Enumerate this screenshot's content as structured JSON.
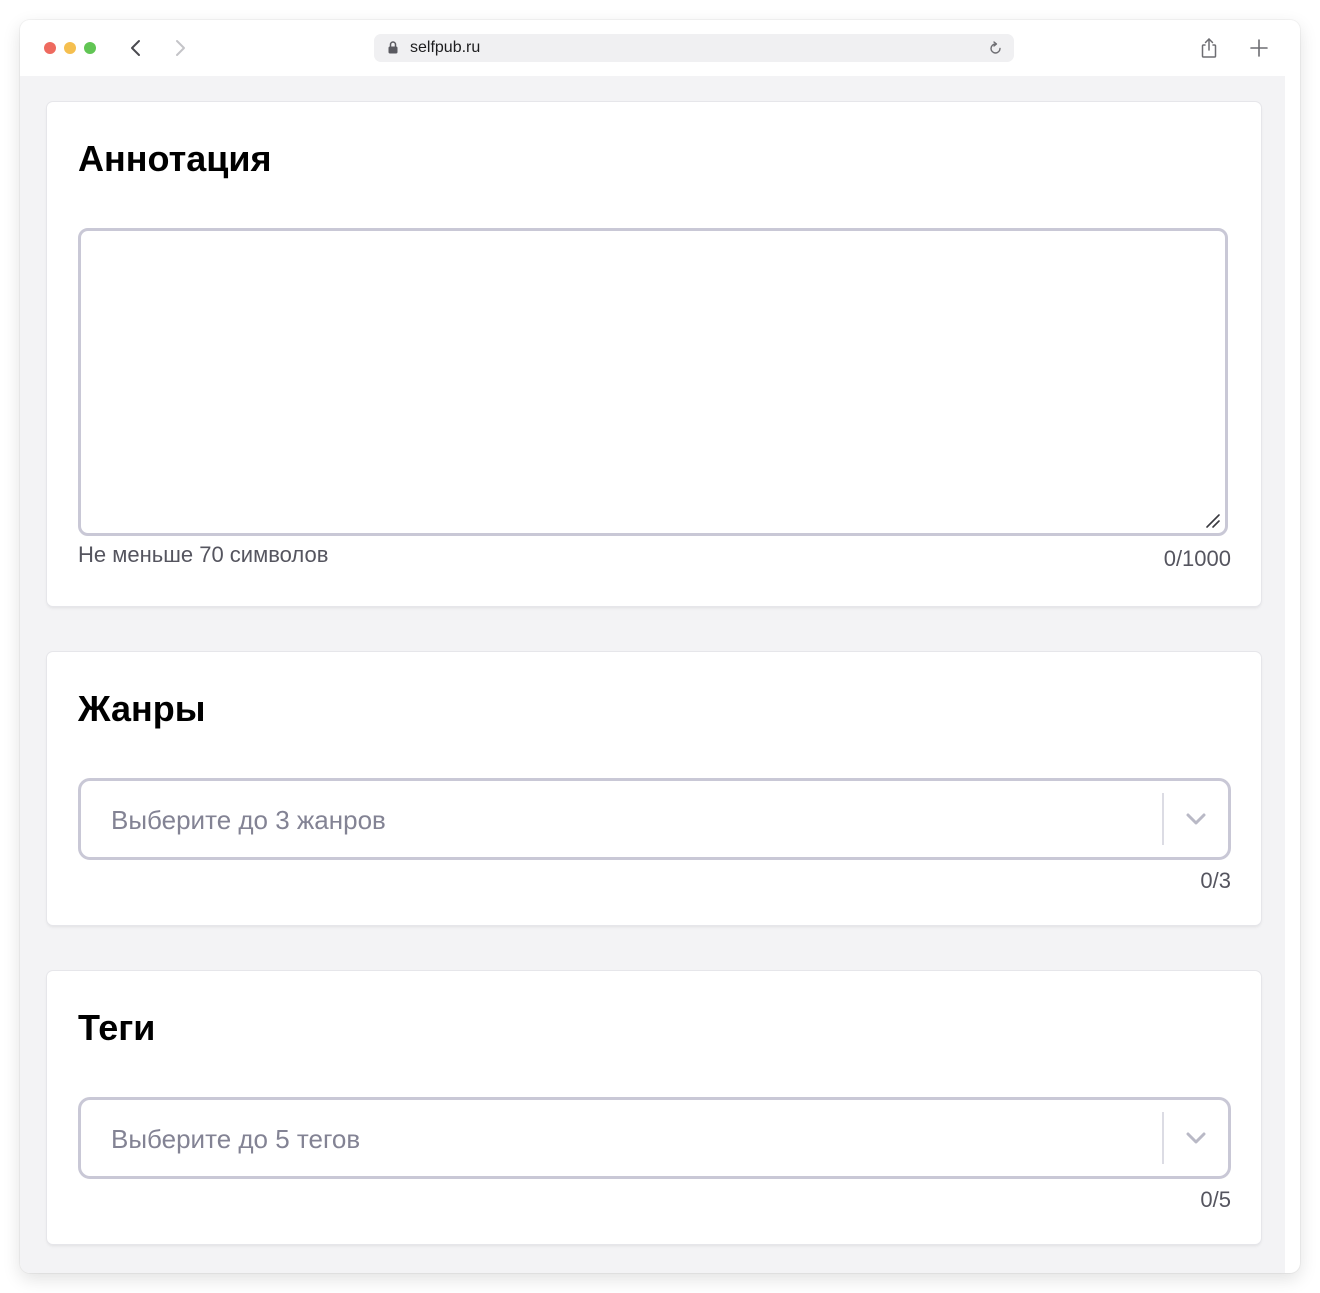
{
  "browser": {
    "url": "selfpub.ru",
    "icons": {
      "back": "chevron-left-icon",
      "forward": "chevron-right-icon",
      "lock": "lock-icon",
      "reload": "reload-icon",
      "share": "share-icon",
      "new_tab": "plus-icon"
    }
  },
  "annotation": {
    "title": "Аннотация",
    "value": "",
    "hint": "Не меньше 70 символов",
    "counter": "0/1000"
  },
  "genres": {
    "title": "Жанры",
    "placeholder": "Выберите до 3 жанров",
    "counter": "0/3"
  },
  "tags": {
    "title": "Теги",
    "placeholder": "Выберите до 5 тегов",
    "counter": "0/5"
  },
  "colors": {
    "field_border": "#c9c8d6",
    "page_background": "#f3f3f5",
    "placeholder_text": "#838394"
  }
}
